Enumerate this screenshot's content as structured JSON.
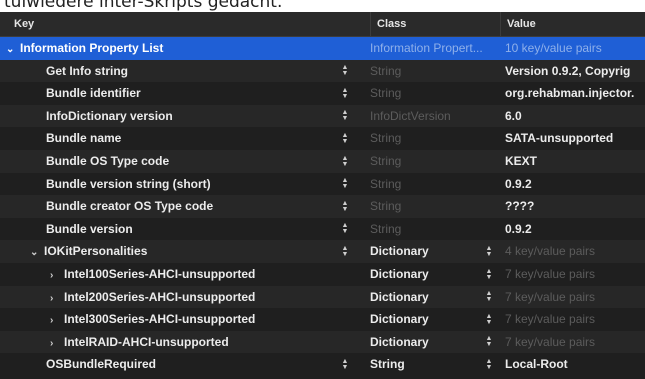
{
  "caption": "tuiwiedere inter-Skripts gedacht.",
  "columns": {
    "key": "Key",
    "class": "Class",
    "value": "Value"
  },
  "rows": [
    {
      "key": "Information Property List",
      "class": "Information Propert...",
      "value": "10 key/value pairs"
    },
    {
      "key": "Get Info string",
      "class": "String",
      "value": "Version 0.9.2, Copyrig"
    },
    {
      "key": "Bundle identifier",
      "class": "String",
      "value": "org.rehabman.injector."
    },
    {
      "key": "InfoDictionary version",
      "class": "InfoDictVersion",
      "value": "6.0"
    },
    {
      "key": "Bundle name",
      "class": "String",
      "value": "SATA-unsupported"
    },
    {
      "key": "Bundle OS Type code",
      "class": "String",
      "value": "KEXT"
    },
    {
      "key": "Bundle version string (short)",
      "class": "String",
      "value": "0.9.2"
    },
    {
      "key": "Bundle creator OS Type code",
      "class": "String",
      "value": "????"
    },
    {
      "key": "Bundle version",
      "class": "String",
      "value": "0.9.2"
    },
    {
      "key": "IOKitPersonalities",
      "class": "Dictionary",
      "value": "4 key/value pairs"
    },
    {
      "key": "Intel100Series-AHCI-unsupported",
      "class": "Dictionary",
      "value": "7 key/value pairs"
    },
    {
      "key": "Intel200Series-AHCI-unsupported",
      "class": "Dictionary",
      "value": "7 key/value pairs"
    },
    {
      "key": "Intel300Series-AHCI-unsupported",
      "class": "Dictionary",
      "value": "7 key/value pairs"
    },
    {
      "key": "IntelRAID-AHCI-unsupported",
      "class": "Dictionary",
      "value": "7 key/value pairs"
    },
    {
      "key": "OSBundleRequired",
      "class": "String",
      "value": "Local-Root"
    }
  ],
  "icons": {
    "expanded": "chevron-down-icon",
    "collapsed": "chevron-right-icon",
    "stepper": "up-down-stepper-icon"
  },
  "colors": {
    "selection": "#1f5fd6",
    "background": "#1f1f1f",
    "dim_text": "#5c5c5c"
  }
}
